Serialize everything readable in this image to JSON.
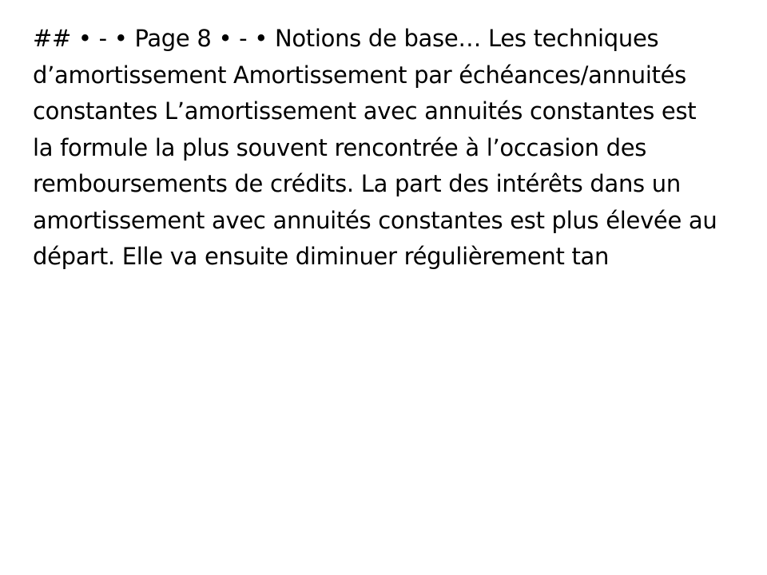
{
  "document": {
    "text": "## • - • Page 8 • - • Notions de base… Les techniques d’amortissement Amortissement par échéances/annuités constantes L’amortissement avec annuités constantes est la formule la plus souvent rencontrée à l’occasion des remboursements de crédits. La part des intérêts dans un amortissement avec annuités constantes est plus élevée au départ. Elle va ensuite diminuer régulièrement tan"
  },
  "colors": {
    "background": "#ffffff",
    "text": "#000000"
  }
}
